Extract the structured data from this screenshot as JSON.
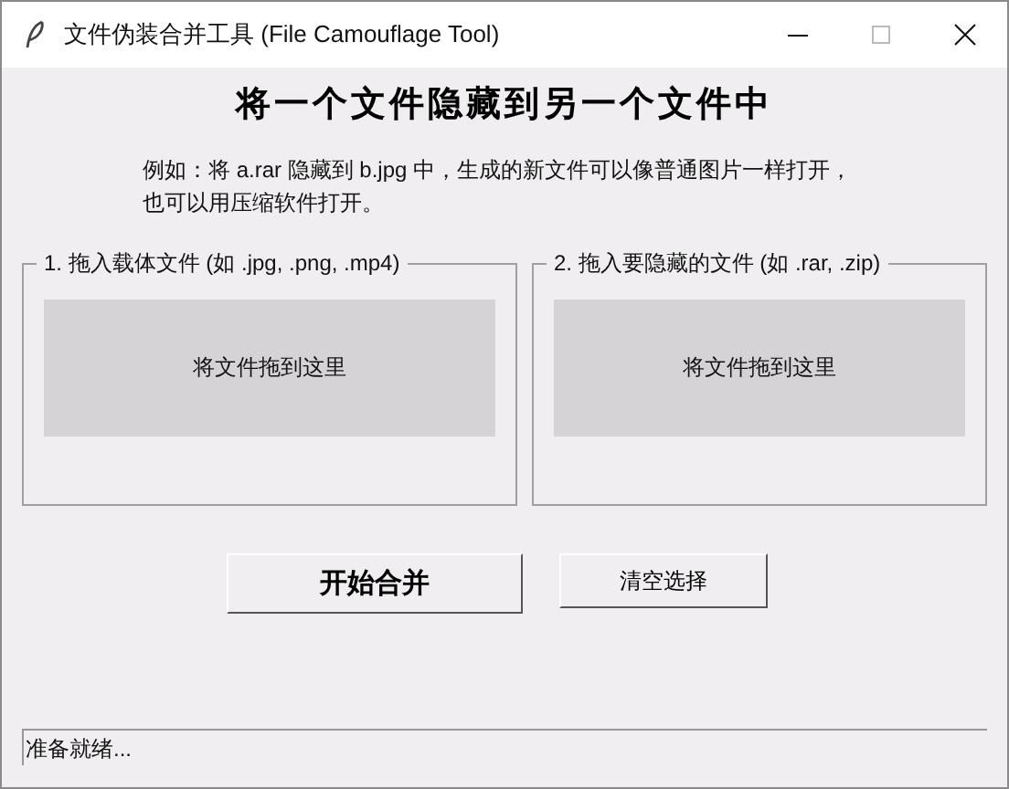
{
  "window": {
    "title": "文件伪装合并工具 (File Camouflage Tool)"
  },
  "heading": "将一个文件隐藏到另一个文件中",
  "description": [
    "例如：将 a.rar 隐藏到 b.jpg 中，生成的新文件可以像普通图片一样打开，",
    "也可以用压缩软件打开。"
  ],
  "groups": [
    {
      "label": "1. 拖入载体文件 (如 .jpg, .png, .mp4)",
      "drop_text": "将文件拖到这里"
    },
    {
      "label": "2. 拖入要隐藏的文件 (如 .rar, .zip)",
      "drop_text": "将文件拖到这里"
    }
  ],
  "buttons": [
    {
      "label": "开始合并",
      "kind": "primary"
    },
    {
      "label": "清空选择",
      "kind": "normal"
    }
  ],
  "status_bar": "准备就绪..."
}
